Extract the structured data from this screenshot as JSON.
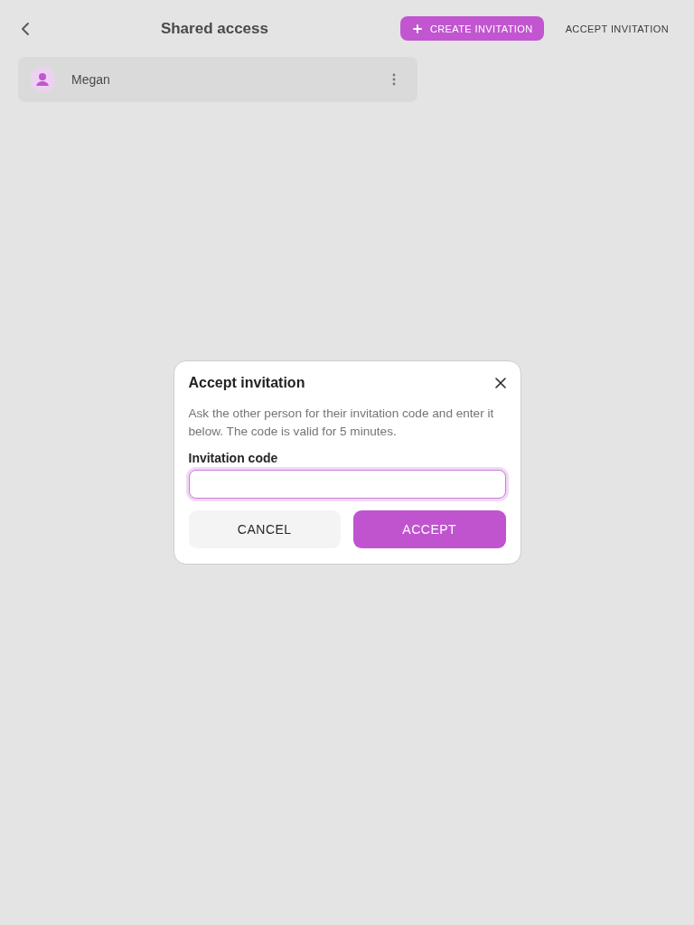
{
  "page": {
    "title": "Shared access",
    "actions": [
      {
        "label": "CREATE INVITATION",
        "kind": "primary"
      },
      {
        "label": "ACCEPT INVITATION",
        "kind": "text"
      }
    ]
  },
  "shared_list": [
    {
      "name": "Megan"
    }
  ],
  "dialog": {
    "title": "Accept invitation",
    "description": "Ask the other person for their invitation code and enter it below. The code is valid for 5 minutes.",
    "field": {
      "label": "Invitation code",
      "focused": true
    },
    "buttons": [
      {
        "label": "CANCEL",
        "kind": "secondary"
      },
      {
        "label": "ACCEPT",
        "kind": "primary"
      }
    ]
  }
}
